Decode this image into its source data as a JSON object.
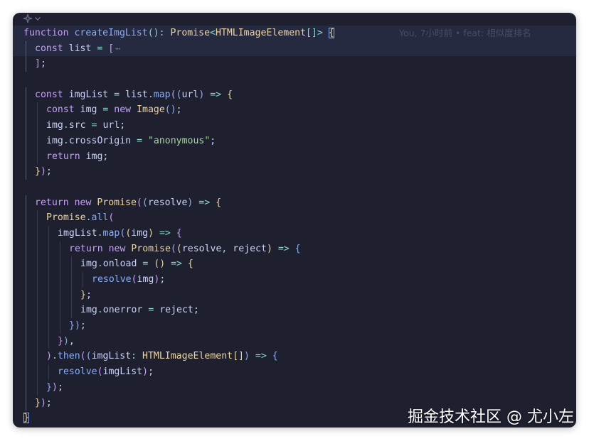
{
  "colors": {
    "keyword": "#c6a0f6",
    "function": "#8aadf4",
    "type": "#eed49f",
    "string": "#a6da95",
    "punct": "#8bd5ca",
    "text": "#cad3f5",
    "gold": "#eed49f",
    "teal": "#8bd5ca",
    "bracket_purple": "#c6a0f6",
    "bracket_blue": "#8aadf4",
    "background": "#1e2030"
  },
  "top_bar": {
    "icons": [
      "sparkle-icon",
      "chevron-down-icon"
    ]
  },
  "blame": "You, 7小时前 • feat: 相似度排名",
  "fold_marker": "⋯",
  "watermark": "掘金技术社区 @ 尤小左",
  "lines": [
    {
      "indent": 0,
      "tokens": [
        [
          "function ",
          "keyword"
        ],
        [
          "createImgList",
          "function"
        ],
        [
          "(): ",
          "punct"
        ],
        [
          "Promise",
          "type"
        ],
        [
          "<",
          "punct"
        ],
        [
          "HTMLImageElement",
          "type"
        ],
        [
          "[]",
          "punct"
        ],
        [
          "> ",
          "punct"
        ],
        [
          "{",
          "gold"
        ]
      ],
      "active": true,
      "blame": true
    },
    {
      "indent": 1,
      "tokens": [
        [
          "const ",
          "keyword"
        ],
        [
          "list ",
          "text"
        ],
        [
          "= ",
          "punct"
        ],
        [
          "[",
          "bracket_purple"
        ],
        [
          "⋯",
          "fold"
        ]
      ],
      "active": true
    },
    {
      "indent": 1,
      "tokens": [
        [
          "]",
          "bracket_purple"
        ],
        [
          ";",
          "text"
        ]
      ]
    },
    {
      "indent": 0,
      "tokens": []
    },
    {
      "indent": 1,
      "tokens": [
        [
          "const ",
          "keyword"
        ],
        [
          "imgList ",
          "text"
        ],
        [
          "= ",
          "punct"
        ],
        [
          "list",
          "text"
        ],
        [
          ".",
          "punct"
        ],
        [
          "map",
          "function"
        ],
        [
          "(",
          "bracket_purple"
        ],
        [
          "(",
          "bracket_blue"
        ],
        [
          "url",
          "text"
        ],
        [
          ")",
          "bracket_blue"
        ],
        [
          " => ",
          "punct"
        ],
        [
          "{",
          "gold"
        ]
      ]
    },
    {
      "indent": 2,
      "tokens": [
        [
          "const ",
          "keyword"
        ],
        [
          "img ",
          "text"
        ],
        [
          "= ",
          "punct"
        ],
        [
          "new ",
          "keyword"
        ],
        [
          "Image",
          "type"
        ],
        [
          "()",
          "bracket_blue"
        ],
        [
          ";",
          "text"
        ]
      ]
    },
    {
      "indent": 2,
      "tokens": [
        [
          "img",
          "text"
        ],
        [
          ".",
          "punct"
        ],
        [
          "src ",
          "text"
        ],
        [
          "= ",
          "punct"
        ],
        [
          "url",
          "text"
        ],
        [
          ";",
          "text"
        ]
      ]
    },
    {
      "indent": 2,
      "tokens": [
        [
          "img",
          "text"
        ],
        [
          ".",
          "punct"
        ],
        [
          "crossOrigin ",
          "text"
        ],
        [
          "= ",
          "punct"
        ],
        [
          "\"anonymous\"",
          "string"
        ],
        [
          ";",
          "text"
        ]
      ]
    },
    {
      "indent": 2,
      "tokens": [
        [
          "return ",
          "keyword"
        ],
        [
          "img",
          "text"
        ],
        [
          ";",
          "text"
        ]
      ]
    },
    {
      "indent": 1,
      "tokens": [
        [
          "}",
          "gold"
        ],
        [
          ")",
          "bracket_purple"
        ],
        [
          ";",
          "text"
        ]
      ]
    },
    {
      "indent": 0,
      "tokens": []
    },
    {
      "indent": 1,
      "tokens": [
        [
          "return ",
          "keyword"
        ],
        [
          "new ",
          "keyword"
        ],
        [
          "Promise",
          "type"
        ],
        [
          "(",
          "bracket_purple"
        ],
        [
          "(",
          "bracket_blue"
        ],
        [
          "resolve",
          "text"
        ],
        [
          ")",
          "bracket_blue"
        ],
        [
          " => ",
          "punct"
        ],
        [
          "{",
          "gold"
        ]
      ]
    },
    {
      "indent": 2,
      "tokens": [
        [
          "Promise",
          "type"
        ],
        [
          ".",
          "punct"
        ],
        [
          "all",
          "function"
        ],
        [
          "(",
          "bracket_purple"
        ]
      ]
    },
    {
      "indent": 3,
      "tokens": [
        [
          "imgList",
          "text"
        ],
        [
          ".",
          "punct"
        ],
        [
          "map",
          "function"
        ],
        [
          "(",
          "bracket_blue"
        ],
        [
          "(",
          "gold"
        ],
        [
          "img",
          "text"
        ],
        [
          ")",
          "gold"
        ],
        [
          " => ",
          "punct"
        ],
        [
          "{",
          "bracket_purple"
        ]
      ]
    },
    {
      "indent": 4,
      "tokens": [
        [
          "return ",
          "keyword"
        ],
        [
          "new ",
          "keyword"
        ],
        [
          "Promise",
          "type"
        ],
        [
          "(",
          "bracket_blue"
        ],
        [
          "(",
          "gold"
        ],
        [
          "resolve",
          "text"
        ],
        [
          ", ",
          "punct"
        ],
        [
          "reject",
          "text"
        ],
        [
          ")",
          "gold"
        ],
        [
          " => ",
          "punct"
        ],
        [
          "{",
          "bracket_blue"
        ]
      ]
    },
    {
      "indent": 5,
      "tokens": [
        [
          "img",
          "text"
        ],
        [
          ".",
          "punct"
        ],
        [
          "onload ",
          "text"
        ],
        [
          "= ",
          "punct"
        ],
        [
          "()",
          "gold"
        ],
        [
          " => ",
          "punct"
        ],
        [
          "{",
          "gold"
        ]
      ]
    },
    {
      "indent": 6,
      "tokens": [
        [
          "resolve",
          "function"
        ],
        [
          "(",
          "bracket_purple"
        ],
        [
          "img",
          "text"
        ],
        [
          ")",
          "bracket_purple"
        ],
        [
          ";",
          "text"
        ]
      ]
    },
    {
      "indent": 5,
      "tokens": [
        [
          "}",
          "gold"
        ],
        [
          ";",
          "text"
        ]
      ]
    },
    {
      "indent": 5,
      "tokens": [
        [
          "img",
          "text"
        ],
        [
          ".",
          "punct"
        ],
        [
          "onerror ",
          "text"
        ],
        [
          "= ",
          "punct"
        ],
        [
          "reject",
          "text"
        ],
        [
          ";",
          "text"
        ]
      ]
    },
    {
      "indent": 4,
      "tokens": [
        [
          "}",
          "bracket_blue"
        ],
        [
          ")",
          "bracket_blue"
        ],
        [
          ";",
          "text"
        ]
      ]
    },
    {
      "indent": 3,
      "tokens": [
        [
          "}",
          "bracket_purple"
        ],
        [
          ")",
          "bracket_blue"
        ],
        [
          ",",
          "text"
        ]
      ]
    },
    {
      "indent": 2,
      "tokens": [
        [
          ")",
          "bracket_purple"
        ],
        [
          ".",
          "punct"
        ],
        [
          "then",
          "function"
        ],
        [
          "(",
          "bracket_purple"
        ],
        [
          "(",
          "bracket_blue"
        ],
        [
          "imgList",
          "text"
        ],
        [
          ": ",
          "punct"
        ],
        [
          "HTMLImageElement",
          "type"
        ],
        [
          "[]",
          "gold"
        ],
        [
          ")",
          "bracket_blue"
        ],
        [
          " => ",
          "punct"
        ],
        [
          "{",
          "bracket_blue"
        ]
      ]
    },
    {
      "indent": 3,
      "tokens": [
        [
          "resolve",
          "function"
        ],
        [
          "(",
          "bracket_purple"
        ],
        [
          "imgList",
          "text"
        ],
        [
          ")",
          "bracket_purple"
        ],
        [
          ";",
          "text"
        ]
      ]
    },
    {
      "indent": 2,
      "tokens": [
        [
          "}",
          "bracket_blue"
        ],
        [
          ")",
          "bracket_purple"
        ],
        [
          ";",
          "text"
        ]
      ]
    },
    {
      "indent": 1,
      "tokens": [
        [
          "}",
          "gold"
        ],
        [
          ")",
          "bracket_purple"
        ],
        [
          ";",
          "text"
        ]
      ]
    },
    {
      "indent": 0,
      "tokens": [
        [
          "}",
          "gold"
        ]
      ],
      "cursor": true
    }
  ]
}
